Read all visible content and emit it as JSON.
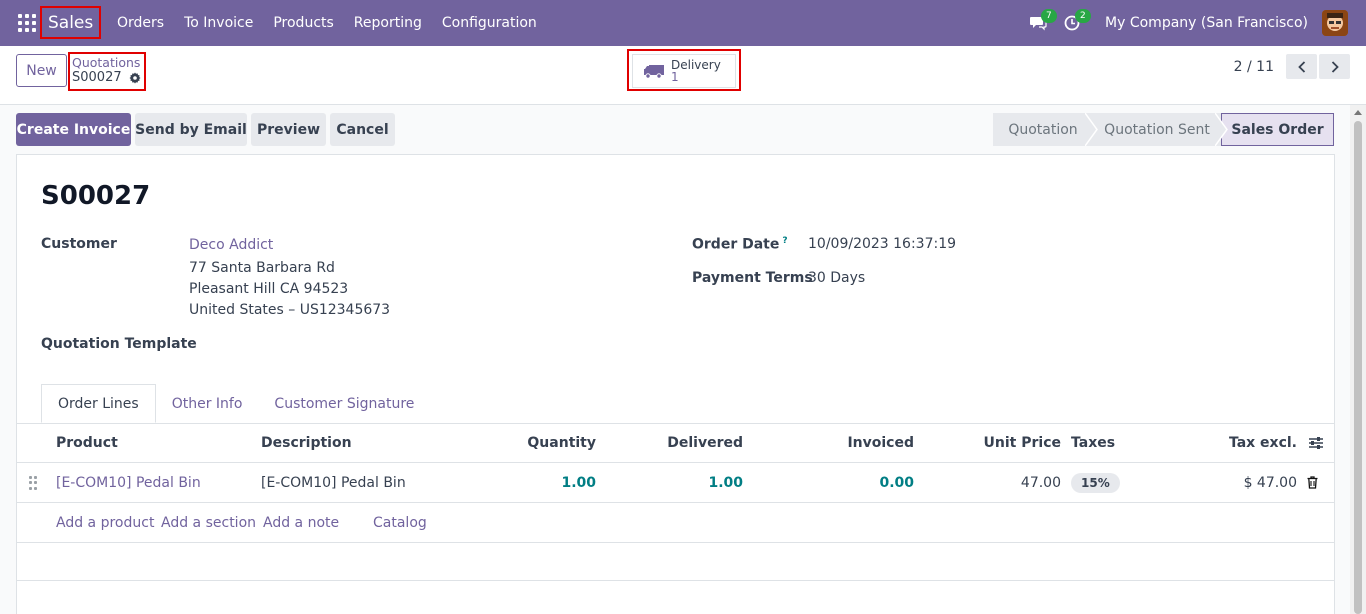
{
  "navbar": {
    "app_name": "Sales",
    "menu": [
      "Orders",
      "To Invoice",
      "Products",
      "Reporting",
      "Configuration"
    ],
    "messages_count": "7",
    "activities_count": "2",
    "company": "My Company (San Francisco)"
  },
  "control_panel": {
    "new_label": "New",
    "breadcrumb_parent": "Quotations",
    "breadcrumb_current": "S00027",
    "smart_button": {
      "label": "Delivery",
      "value": "1"
    },
    "pager": "2 / 11"
  },
  "statusbar": {
    "buttons": [
      "Create Invoice",
      "Send by Email",
      "Preview",
      "Cancel"
    ],
    "stages": [
      "Quotation",
      "Quotation Sent",
      "Sales Order"
    ],
    "active_stage": "Sales Order"
  },
  "form": {
    "title": "S00027",
    "customer_label": "Customer",
    "customer_name": "Deco Addict",
    "address_line1": "77 Santa Barbara Rd",
    "address_line2": "Pleasant Hill CA 94523",
    "address_line3": "United States – US12345673",
    "template_label": "Quotation Template",
    "order_date_label": "Order Date",
    "order_date_help": "?",
    "order_date": "10/09/2023 16:37:19",
    "payment_terms_label": "Payment Terms",
    "payment_terms": "30 Days"
  },
  "tabs": [
    "Order Lines",
    "Other Info",
    "Customer Signature"
  ],
  "order_lines": {
    "columns": [
      "Product",
      "Description",
      "Quantity",
      "Delivered",
      "Invoiced",
      "Unit Price",
      "Taxes",
      "Tax excl."
    ],
    "rows": [
      {
        "product": "[E-COM10] Pedal Bin",
        "description": "[E-COM10] Pedal Bin",
        "quantity": "1.00",
        "delivered": "1.00",
        "invoiced": "0.00",
        "unit_price": "47.00",
        "taxes": "15%",
        "subtotal": "$ 47.00"
      }
    ],
    "add_links": [
      "Add a product",
      "Add a section",
      "Add a note",
      "Catalog"
    ]
  },
  "colors": {
    "brand": "#71639e",
    "highlight": "#e00000",
    "accent": "#017e84"
  }
}
